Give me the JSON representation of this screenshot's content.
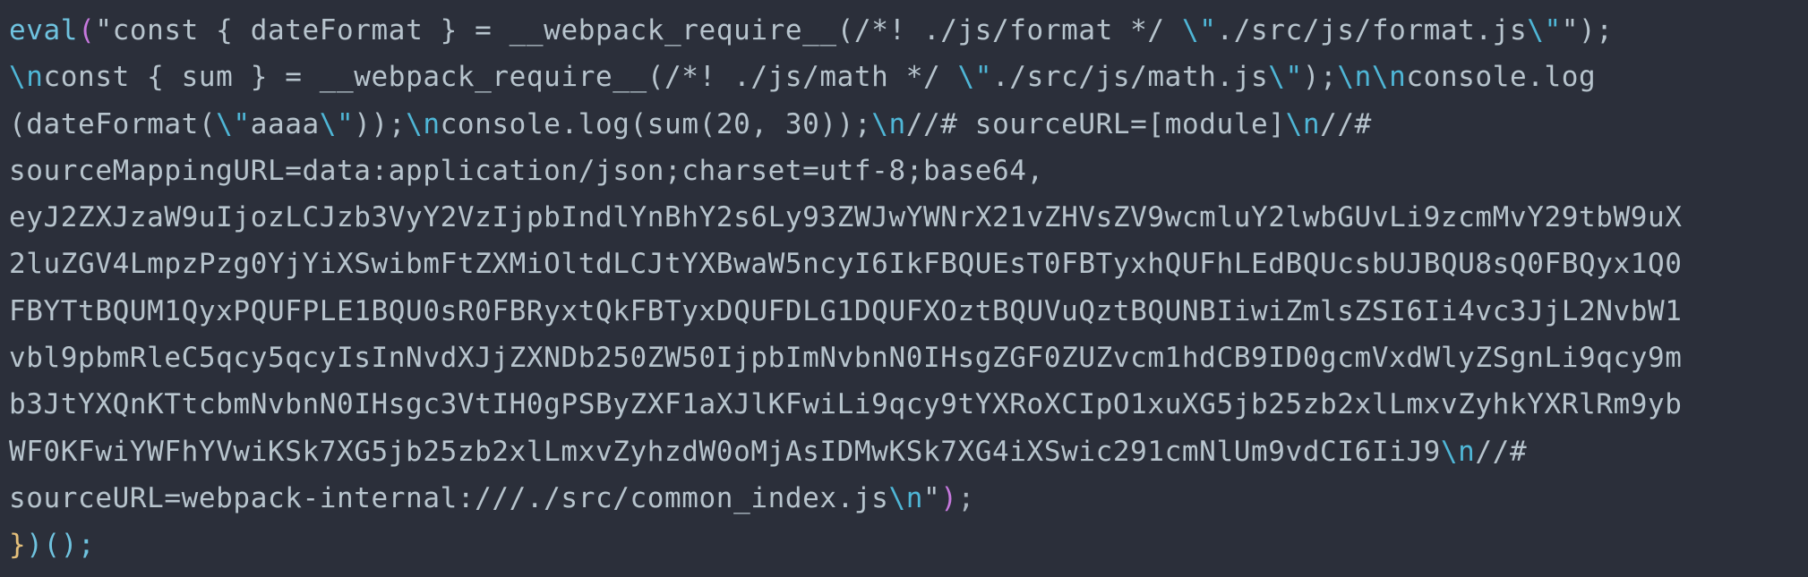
{
  "editor": {
    "lines": [
      [
        {
          "t": "eval",
          "c": "fn"
        },
        {
          "t": "(",
          "c": "paren"
        },
        {
          "t": "\"const { dateFormat } = __webpack_require__(/*! ./js/format */ ",
          "c": "str"
        },
        {
          "t": "\\\"",
          "c": "esc"
        },
        {
          "t": "./src/js/format.js",
          "c": "str"
        },
        {
          "t": "\\\"",
          "c": "esc"
        },
        {
          "t": "\");",
          "c": "str"
        }
      ],
      [
        {
          "t": "\\n",
          "c": "esc"
        },
        {
          "t": "const { sum } = __webpack_require__(/*! ./js/math */ ",
          "c": "str"
        },
        {
          "t": "\\\"",
          "c": "esc"
        },
        {
          "t": "./src/js/math.js",
          "c": "str"
        },
        {
          "t": "\\\"",
          "c": "esc"
        },
        {
          "t": ");",
          "c": "str"
        },
        {
          "t": "\\n\\n",
          "c": "esc"
        },
        {
          "t": "console.log",
          "c": "str"
        }
      ],
      [
        {
          "t": "(dateFormat(",
          "c": "str"
        },
        {
          "t": "\\\"",
          "c": "esc"
        },
        {
          "t": "aaaa",
          "c": "str"
        },
        {
          "t": "\\\"",
          "c": "esc"
        },
        {
          "t": "));",
          "c": "str"
        },
        {
          "t": "\\n",
          "c": "esc"
        },
        {
          "t": "console.log(sum(20, 30));",
          "c": "str"
        },
        {
          "t": "\\n",
          "c": "esc"
        },
        {
          "t": "//# sourceURL=[module]",
          "c": "str"
        },
        {
          "t": "\\n",
          "c": "esc"
        },
        {
          "t": "//#",
          "c": "str"
        }
      ],
      [
        {
          "t": "sourceMappingURL=data:application/json;charset=utf-8;base64,",
          "c": "str"
        }
      ],
      [
        {
          "t": "eyJ2ZXJzaW9uIjozLCJzb3VyY2VzIjpbIndlYnBhY2s6Ly93ZWJwYWNrX21vZHVsZV9wcmluY2lwbGUvLi9zcmMvY29tbW9uX",
          "c": "str"
        }
      ],
      [
        {
          "t": "2luZGV4LmpzPzg0YjYiXSwibmFtZXMiOltdLCJtYXBwaW5ncyI6IkFBQUEsT0FBTyxhQUFhLEdBQUcsbUJBQU8sQ0FBQyx1Q0",
          "c": "str"
        }
      ],
      [
        {
          "t": "FBYTtBQUM1QyxPQUFPLE1BQU0sR0FBRyxtQkFBTyxDQUFDLG1DQUFXOztBQUVuQztBQUNBIiwiZmlsZSI6Ii4vc3JjL2NvbW1",
          "c": "str"
        }
      ],
      [
        {
          "t": "vbl9pbmRleC5qcy5qcyIsInNvdXJjZXNDb250ZW50IjpbImNvbnN0IHsgZGF0ZUZvcm1hdCB9ID0gcmVxdWlyZSgnLi9qcy9m",
          "c": "str"
        }
      ],
      [
        {
          "t": "b3JtYXQnKTtcbmNvbnN0IHsgc3VtIH0gPSByZXF1aXJlKFwiLi9qcy9tYXRoXCIpO1xuXG5jb25zb2xlLmxvZyhkYXRlRm9yb",
          "c": "str"
        }
      ],
      [
        {
          "t": "WF0KFwiYWFhYVwiKSk7XG5jb25zb2xlLmxvZyhzdW0oMjAsIDMwKSk7XG4iXSwic291cmNlUm9vdCI6IiJ9",
          "c": "str"
        },
        {
          "t": "\\n",
          "c": "esc"
        },
        {
          "t": "//#",
          "c": "str"
        }
      ],
      [
        {
          "t": "sourceURL=webpack-internal:///./src/common_index.js",
          "c": "str"
        },
        {
          "t": "\\n",
          "c": "esc"
        },
        {
          "t": "\"",
          "c": "str"
        },
        {
          "t": ")",
          "c": "paren"
        },
        {
          "t": ";",
          "c": "plain"
        }
      ],
      [
        {
          "t": "}",
          "c": "brace"
        },
        {
          "t": ")();",
          "c": "fn"
        }
      ]
    ]
  }
}
